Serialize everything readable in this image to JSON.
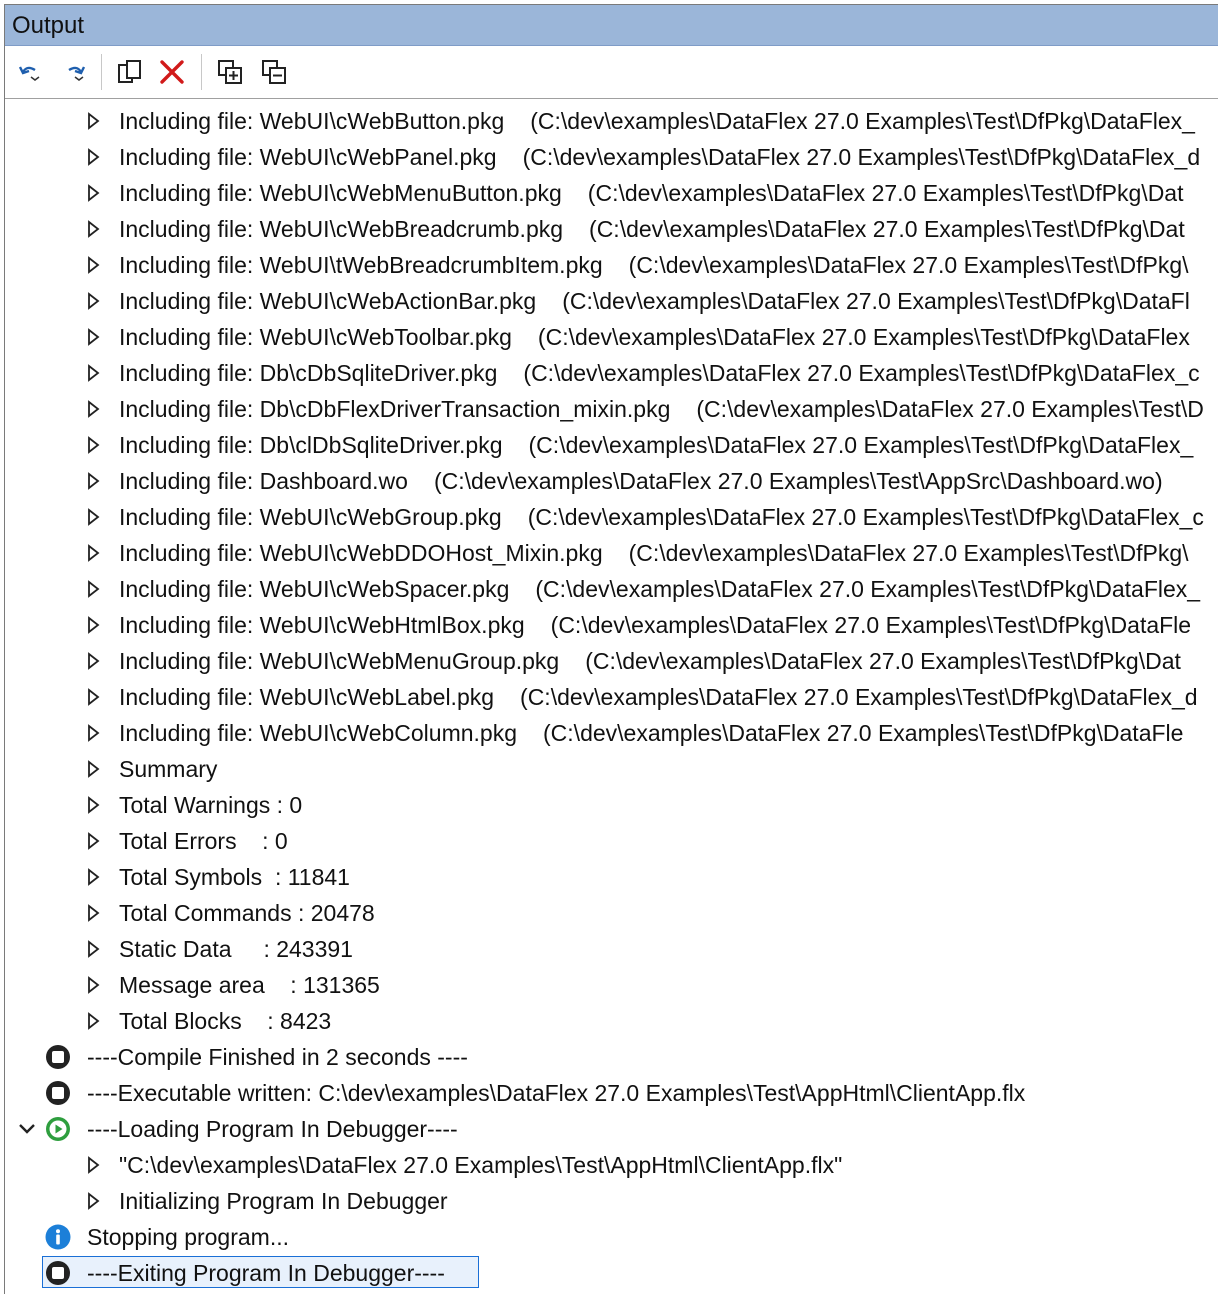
{
  "panel": {
    "title": "Output"
  },
  "toolbar": {
    "buttons": [
      "undo-arrow-icon",
      "redo-arrow-icon",
      "copy-icon",
      "delete-icon",
      "expand-all-icon",
      "collapse-all-icon"
    ],
    "delete_color": "#d11a1a"
  },
  "includes": [
    {
      "label": "Including file: WebUI\\cWebButton.pkg",
      "path": "(C:\\dev\\examples\\DataFlex 27.0 Examples\\Test\\DfPkg\\DataFlex_"
    },
    {
      "label": "Including file: WebUI\\cWebPanel.pkg",
      "path": "(C:\\dev\\examples\\DataFlex 27.0 Examples\\Test\\DfPkg\\DataFlex_d"
    },
    {
      "label": "Including file: WebUI\\cWebMenuButton.pkg",
      "path": "(C:\\dev\\examples\\DataFlex 27.0 Examples\\Test\\DfPkg\\Dat"
    },
    {
      "label": "Including file: WebUI\\cWebBreadcrumb.pkg",
      "path": "(C:\\dev\\examples\\DataFlex 27.0 Examples\\Test\\DfPkg\\Dat"
    },
    {
      "label": "Including file: WebUI\\tWebBreadcrumbItem.pkg",
      "path": "(C:\\dev\\examples\\DataFlex 27.0 Examples\\Test\\DfPkg\\"
    },
    {
      "label": "Including file: WebUI\\cWebActionBar.pkg",
      "path": "(C:\\dev\\examples\\DataFlex 27.0 Examples\\Test\\DfPkg\\DataFl"
    },
    {
      "label": "Including file: WebUI\\cWebToolbar.pkg",
      "path": "(C:\\dev\\examples\\DataFlex 27.0 Examples\\Test\\DfPkg\\DataFlex"
    },
    {
      "label": "Including file: Db\\cDbSqliteDriver.pkg",
      "path": "(C:\\dev\\examples\\DataFlex 27.0 Examples\\Test\\DfPkg\\DataFlex_c"
    },
    {
      "label": "Including file: Db\\cDbFlexDriverTransaction_mixin.pkg",
      "path": "(C:\\dev\\examples\\DataFlex 27.0 Examples\\Test\\D"
    },
    {
      "label": "Including file: Db\\clDbSqliteDriver.pkg",
      "path": "(C:\\dev\\examples\\DataFlex 27.0 Examples\\Test\\DfPkg\\DataFlex_"
    },
    {
      "label": "Including file: Dashboard.wo",
      "path": "(C:\\dev\\examples\\DataFlex 27.0 Examples\\Test\\AppSrc\\Dashboard.wo)"
    },
    {
      "label": "Including file: WebUI\\cWebGroup.pkg",
      "path": "(C:\\dev\\examples\\DataFlex 27.0 Examples\\Test\\DfPkg\\DataFlex_c"
    },
    {
      "label": "Including file: WebUI\\cWebDDOHost_Mixin.pkg",
      "path": "(C:\\dev\\examples\\DataFlex 27.0 Examples\\Test\\DfPkg\\"
    },
    {
      "label": "Including file: WebUI\\cWebSpacer.pkg",
      "path": "(C:\\dev\\examples\\DataFlex 27.0 Examples\\Test\\DfPkg\\DataFlex_"
    },
    {
      "label": "Including file: WebUI\\cWebHtmlBox.pkg",
      "path": "(C:\\dev\\examples\\DataFlex 27.0 Examples\\Test\\DfPkg\\DataFle"
    },
    {
      "label": "Including file: WebUI\\cWebMenuGroup.pkg",
      "path": "(C:\\dev\\examples\\DataFlex 27.0 Examples\\Test\\DfPkg\\Dat"
    },
    {
      "label": "Including file: WebUI\\cWebLabel.pkg",
      "path": "(C:\\dev\\examples\\DataFlex 27.0 Examples\\Test\\DfPkg\\DataFlex_d"
    },
    {
      "label": "Including file: WebUI\\cWebColumn.pkg",
      "path": "(C:\\dev\\examples\\DataFlex 27.0 Examples\\Test\\DfPkg\\DataFle"
    }
  ],
  "summary": [
    "Summary",
    "Total Warnings : 0",
    "Total Errors    : 0",
    "Total Symbols  : 11841",
    "Total Commands : 20478",
    "Static Data     : 243391",
    "Message area    : 131365",
    "Total Blocks    : 8423"
  ],
  "status": {
    "compile_finished": "----Compile Finished in 2 seconds ----",
    "executable_written": "----Executable written: C:\\dev\\examples\\DataFlex 27.0 Examples\\Test\\AppHtml\\ClientApp.flx",
    "loading": "----Loading Program In Debugger----",
    "loading_children": [
      "\"C:\\dev\\examples\\DataFlex 27.0 Examples\\Test\\AppHtml\\ClientApp.flx\"",
      "Initializing Program In Debugger"
    ],
    "stopping": "Stopping program...",
    "exiting": "----Exiting Program In Debugger----"
  },
  "colors": {
    "header": "#9bb6d9",
    "play_green": "#2e9e3e",
    "info_blue": "#1c7fd8",
    "selection_border": "#1a6fd6"
  }
}
